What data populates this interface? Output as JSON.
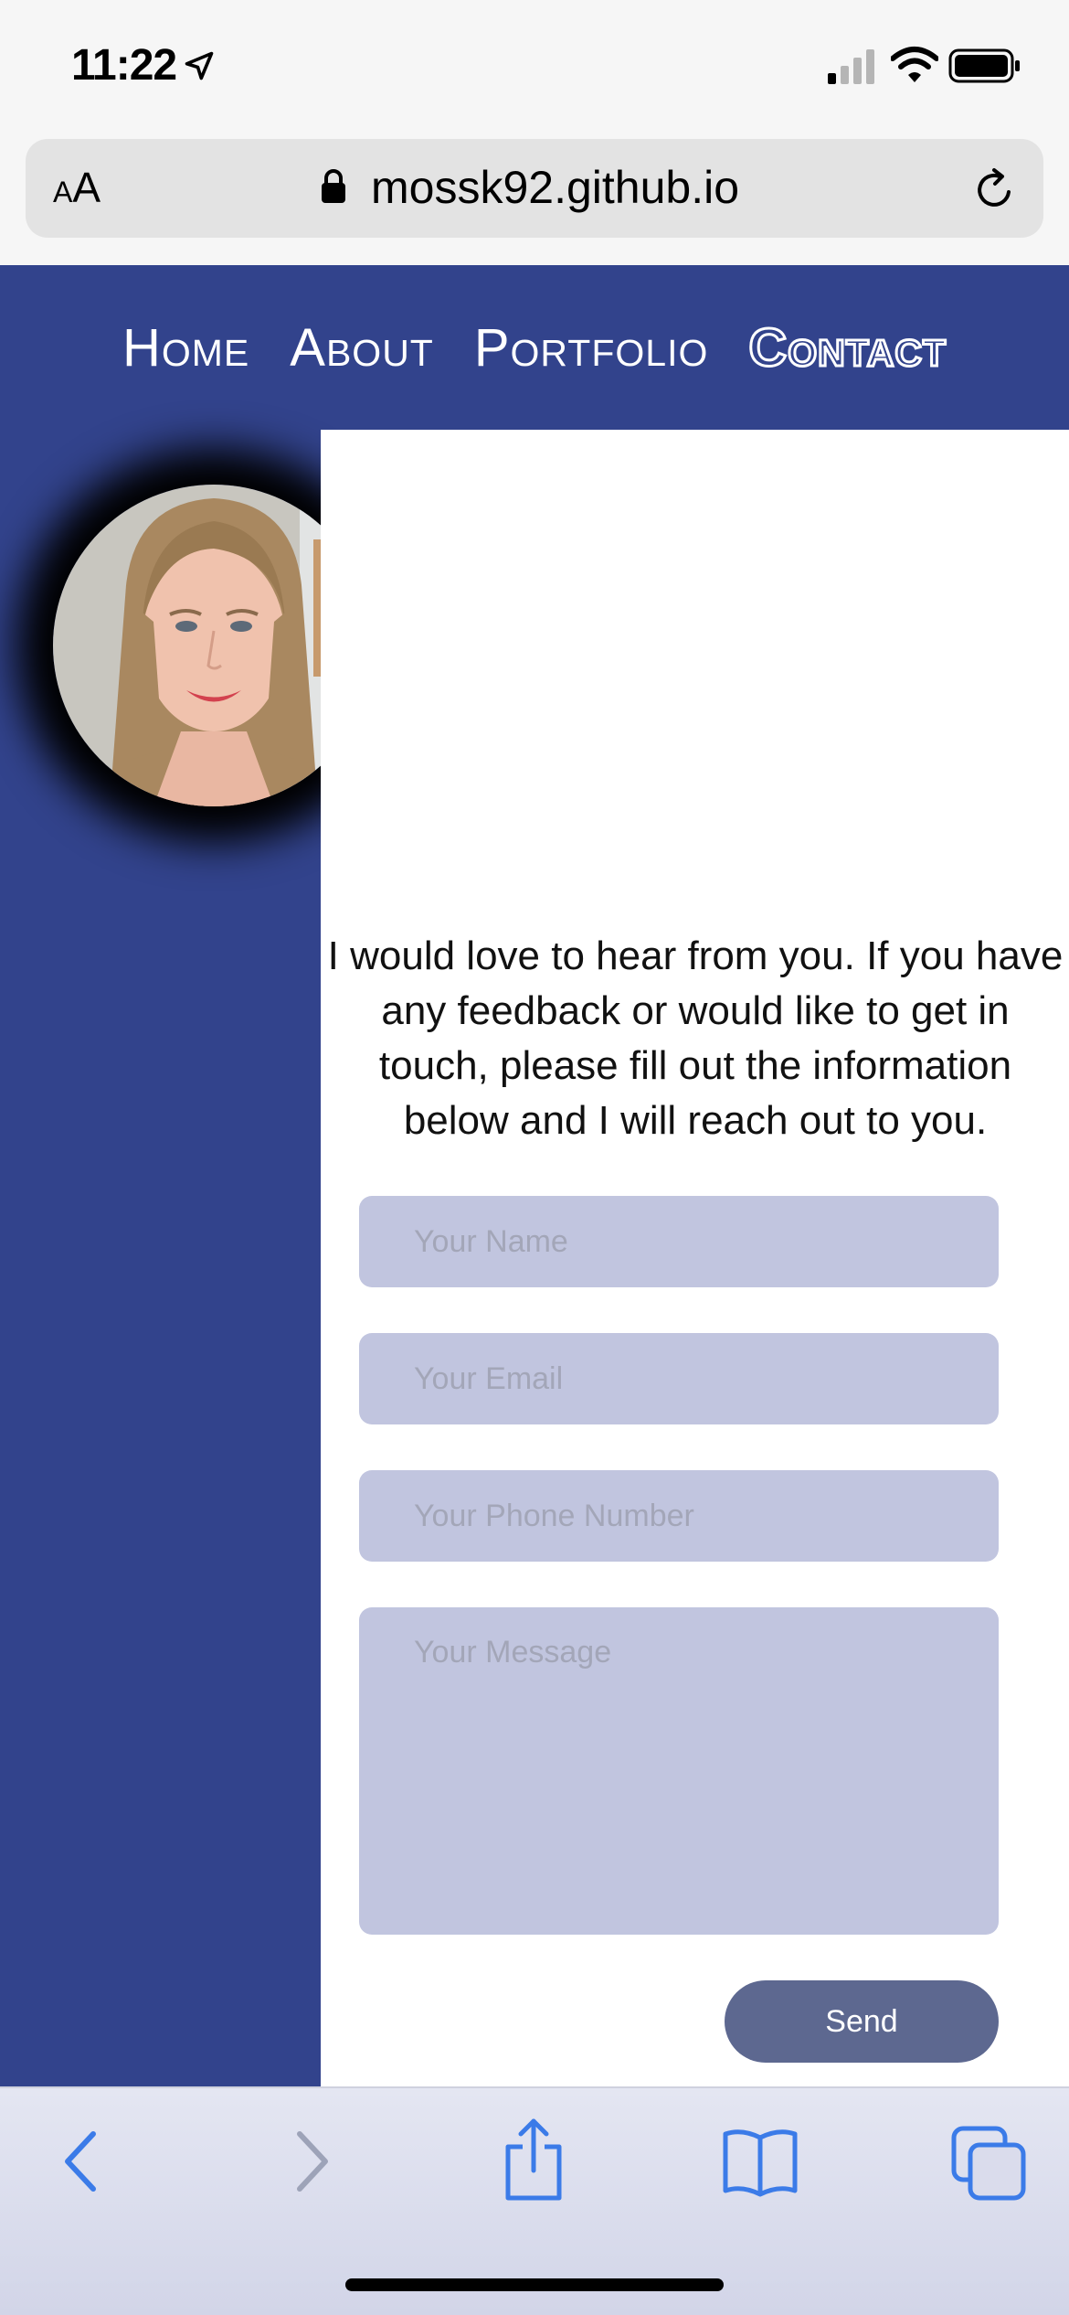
{
  "status_bar": {
    "time": "11:22"
  },
  "browser": {
    "url": "mossk92.github.io",
    "aa_small": "A",
    "aa_large": "A"
  },
  "nav": {
    "items": [
      {
        "label": "Home"
      },
      {
        "label": "About"
      },
      {
        "label": "Portfolio"
      },
      {
        "label": "Contact"
      }
    ]
  },
  "contact": {
    "intro": "I would love to hear from you. If you have any feedback or would like to get in touch, please fill out the information below and I will reach out to you.",
    "name_placeholder": "Your Name",
    "email_placeholder": "Your Email",
    "phone_placeholder": "Your Phone Number",
    "message_placeholder": "Your Message",
    "send_label": "Send"
  },
  "colors": {
    "brand_blue": "#32438c",
    "input_fill": "#c1c5df",
    "send_button": "#5d6890",
    "toolbar_icon": "#3b7be8"
  }
}
